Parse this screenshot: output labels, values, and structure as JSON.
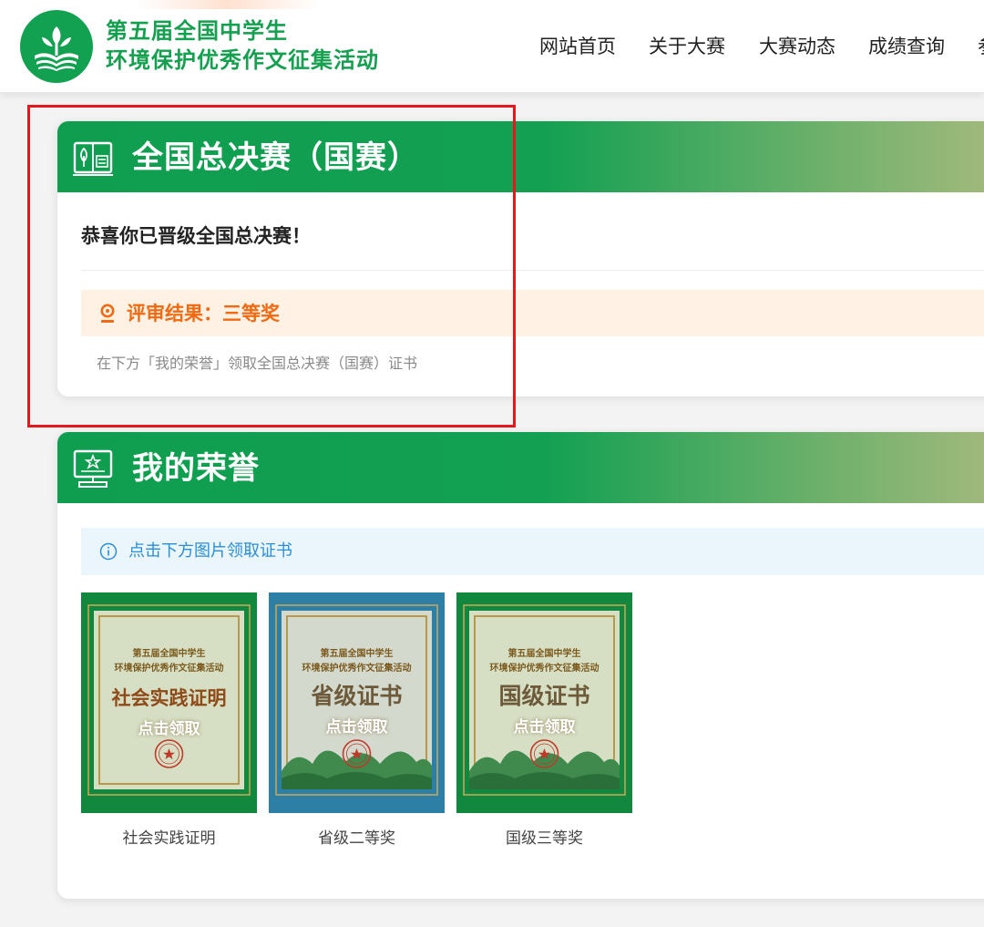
{
  "header": {
    "title_line1": "第五届全国中学生",
    "title_line2": "环境保护优秀作文征集活动",
    "nav": [
      "网站首页",
      "关于大赛",
      "大赛动态",
      "成绩查询",
      "参"
    ]
  },
  "final": {
    "title": "全国总决赛（国赛）",
    "congrats": "恭喜你已晋级全国总决赛！",
    "result": "评审结果：三等奖",
    "hint": "在下方「我的荣誉」领取全国总决赛（国赛）证书"
  },
  "honor": {
    "title": "我的荣誉",
    "info": "点击下方图片领取证书",
    "certs": [
      {
        "small1": "第五届全国中学生",
        "small2": "环境保护优秀作文征集活动",
        "big": "社会实践证明",
        "claim": "点击领取",
        "caption": "社会实践证明",
        "border_color": "#12883e"
      },
      {
        "small1": "第五届全国中学生",
        "small2": "环境保护优秀作文征集活动",
        "big": "省级证书",
        "claim": "点击领取",
        "caption": "省级二等奖",
        "border_color": "#2e7fa6"
      },
      {
        "small1": "第五届全国中学生",
        "small2": "环境保护优秀作文征集活动",
        "big": "国级证书",
        "claim": "点击领取",
        "caption": "国级三等奖",
        "border_color": "#12883e"
      }
    ]
  },
  "colors": {
    "brand_green": "#12a150",
    "result_orange": "#ef6a12",
    "info_blue": "#2a8fd6",
    "highlight_red": "#e3191f"
  }
}
